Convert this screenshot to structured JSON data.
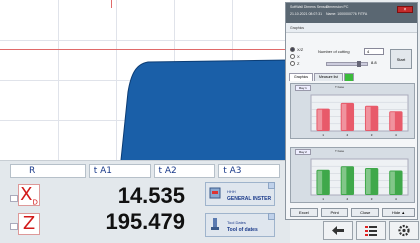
{
  "readout": {
    "headers": [
      "R",
      "t A1",
      "t A2",
      "t A3"
    ],
    "axes": [
      {
        "letter": "X",
        "sub": "D",
        "value": "14.535"
      },
      {
        "letter": "Z",
        "sub": "",
        "value": "195.479"
      }
    ],
    "tool_cards": [
      {
        "line1": "HHH",
        "line2": "GENERAL INSTER"
      },
      {
        "line1": "Tool Dates",
        "line2": "Tool of dates"
      }
    ]
  },
  "dialog": {
    "title_lines": [
      "SoftWall Dimens Sensor",
      "21.10.2021 08:07:31",
      "Dimension PC",
      "Name: 1000000776 FITFA"
    ],
    "close_label": "×",
    "sub_title": "Graphics",
    "radios": [
      {
        "label": "X/Z",
        "on": true
      },
      {
        "label": "X",
        "on": false
      },
      {
        "label": "Z",
        "on": false
      }
    ],
    "cutting_label": "Number of cutting",
    "cutting_value": "4",
    "slider_value": "8.8",
    "start_label": "Start",
    "tabs": [
      "Graphics",
      "Measure list",
      ""
    ],
    "chart1": {
      "tag": "Ray 1",
      "header": "T base"
    },
    "chart2": {
      "tag": "Ray 2",
      "header": "T base"
    },
    "buttons": [
      "Excel",
      "Print",
      "Close",
      "Hide ▲"
    ]
  },
  "chart_data": [
    {
      "type": "bar",
      "categories": [
        "1",
        "2",
        "3",
        "4"
      ],
      "values": [
        0.62,
        0.78,
        0.7,
        0.55
      ],
      "color": "#e85a6a"
    },
    {
      "type": "bar",
      "categories": [
        "1",
        "2",
        "3",
        "4"
      ],
      "values": [
        0.7,
        0.8,
        0.75,
        0.68
      ],
      "color": "#3fa84a"
    }
  ],
  "colors": {
    "profile": "#1a5fa8",
    "axis": "#d21a1a",
    "close": "#c42a2a"
  }
}
